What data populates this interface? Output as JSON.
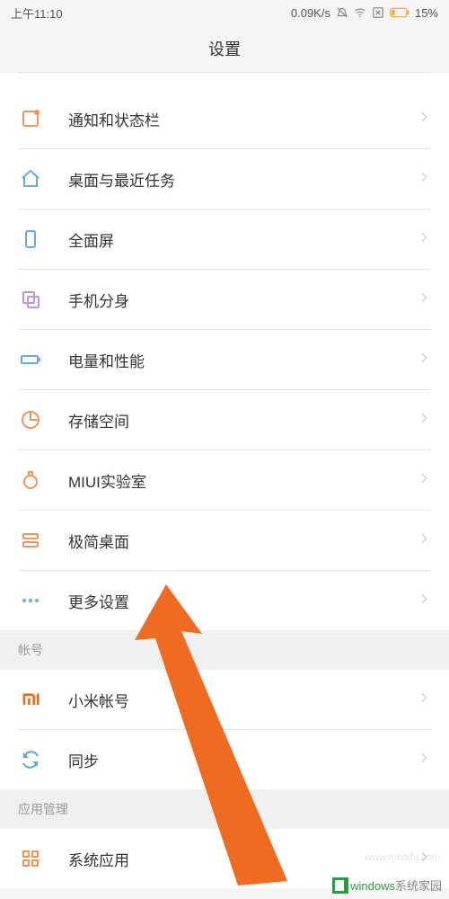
{
  "statusbar": {
    "time": "上午11:10",
    "speed": "0.09K/s",
    "battery": "15%"
  },
  "header": {
    "title": "设置"
  },
  "items": [
    {
      "label": "通知和状态栏"
    },
    {
      "label": "桌面与最近任务"
    },
    {
      "label": "全面屏"
    },
    {
      "label": "手机分身"
    },
    {
      "label": "电量和性能"
    },
    {
      "label": "存储空间"
    },
    {
      "label": "MIUI实验室"
    },
    {
      "label": "极简桌面"
    },
    {
      "label": "更多设置"
    }
  ],
  "sections": {
    "account": {
      "header": "帐号",
      "items": [
        {
          "label": "小米帐号"
        },
        {
          "label": "同步"
        }
      ]
    },
    "appmgmt": {
      "header": "应用管理",
      "items": [
        {
          "label": "系统应用"
        }
      ]
    }
  },
  "watermark": {
    "faint": "www.ruhaifu.com",
    "brand_prefix": "windows",
    "brand_suffix": "系统家园"
  },
  "colors": {
    "accent_orange": "#f06a1f",
    "icon_blue": "#6aa8e6",
    "icon_orange": "#f2955a",
    "icon_purple": "#b99ad4",
    "icon_mi": "#f26a1a",
    "icon_sync": "#5aa6d8",
    "icon_grid": "#f2955a"
  }
}
